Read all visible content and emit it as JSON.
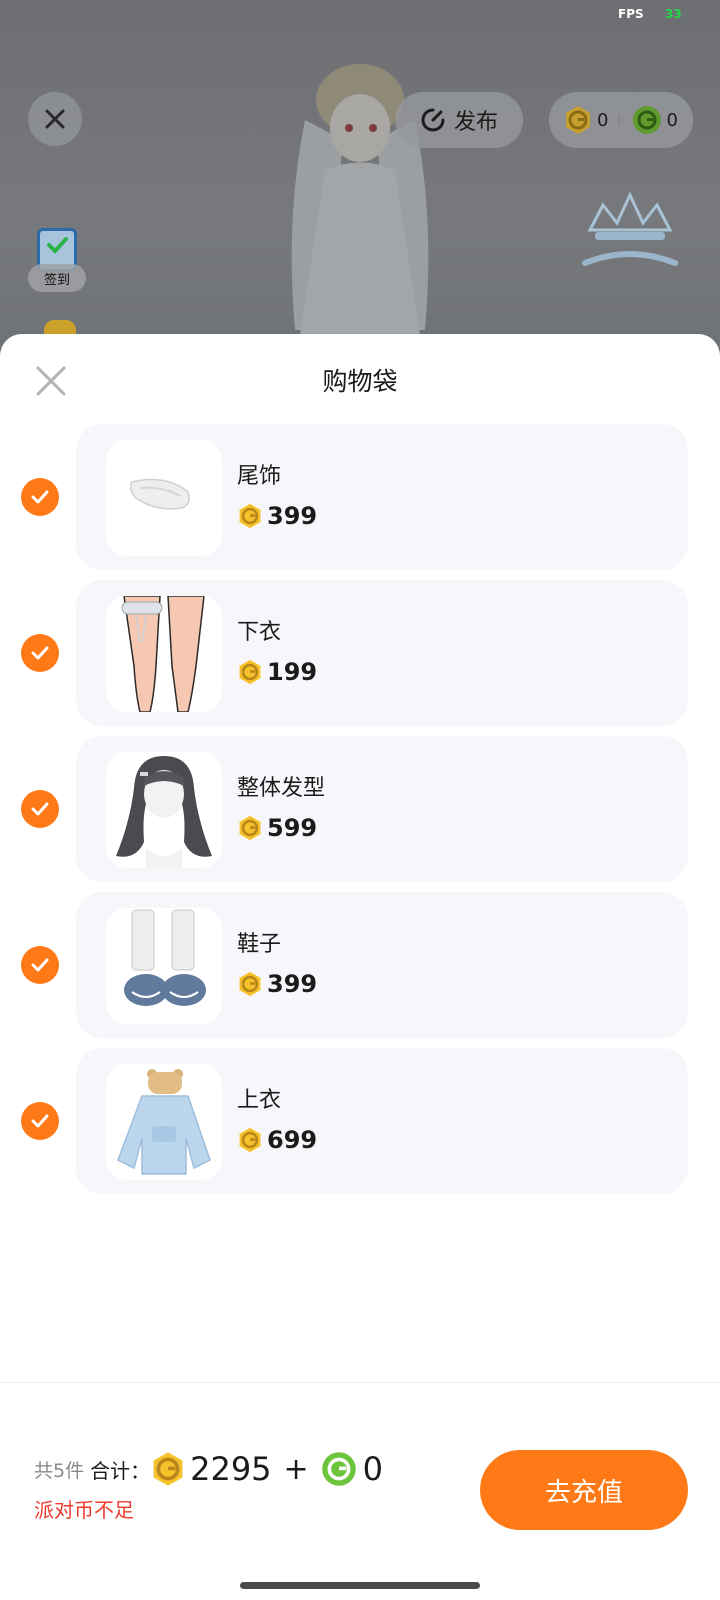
{
  "status": {
    "fps_label": "FPS",
    "fps_value": "33"
  },
  "top_bar": {
    "publish_label": "发布",
    "gold_balance": "0",
    "green_balance": "0",
    "signin_label": "签到"
  },
  "sheet": {
    "title": "购物袋",
    "items": [
      {
        "name": "尾饰",
        "price": "399",
        "checked": true
      },
      {
        "name": "下衣",
        "price": "199",
        "checked": true
      },
      {
        "name": "整体发型",
        "price": "599",
        "checked": true
      },
      {
        "name": "鞋子",
        "price": "399",
        "checked": true
      },
      {
        "name": "上衣",
        "price": "699",
        "checked": true
      }
    ]
  },
  "footer": {
    "count_text": "共5件",
    "total_label": "合计：",
    "gold_total": "2295",
    "plus": "+",
    "green_total": "0",
    "warning": "派对币不足",
    "recharge_label": "去充值"
  },
  "colors": {
    "accent": "#ff7a17",
    "warning": "#ef3b2c",
    "gold_coin": "#f5c22b",
    "green_coin": "#6cc43a",
    "card_bg": "#f7f6fa"
  }
}
